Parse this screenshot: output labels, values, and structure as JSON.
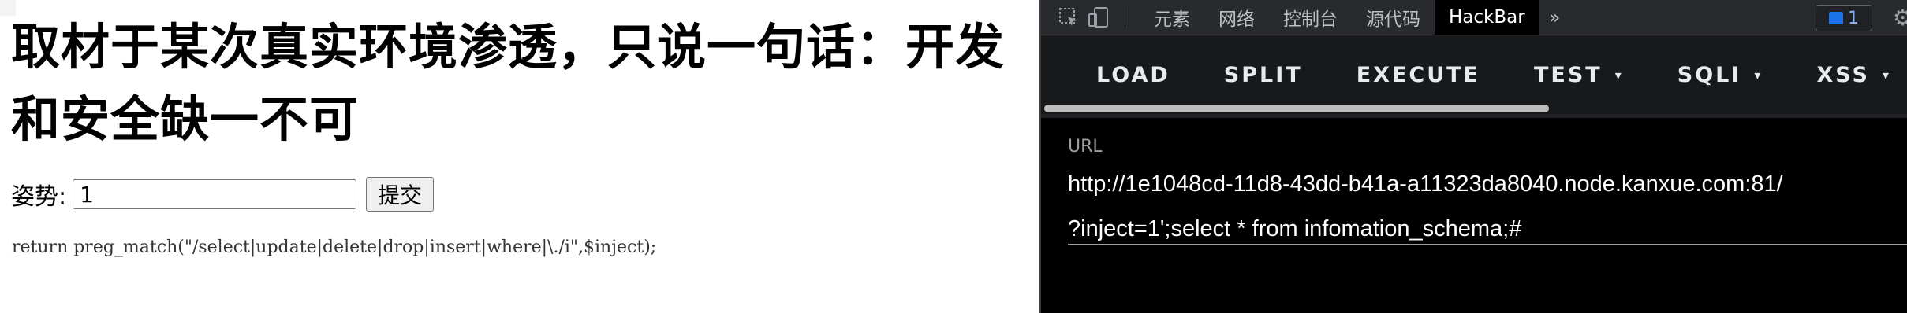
{
  "page": {
    "headline": "取材于某次真实环境渗透，只说一句话：开发和安全缺一不可",
    "form": {
      "label": "姿势:",
      "input_value": "1",
      "submit_label": "提交"
    },
    "code": "return preg_match(\"/select|update|delete|drop|insert|where|\\./i\",$inject);"
  },
  "devtools": {
    "tabs": [
      {
        "label": "元素"
      },
      {
        "label": "网络"
      },
      {
        "label": "控制台"
      },
      {
        "label": "源代码"
      },
      {
        "label": "HackBar"
      }
    ],
    "active_tab": "HackBar",
    "more_label": "»",
    "badge_count": "1",
    "icons": [
      "inspect-icon",
      "device-toggle-icon",
      "overflow-chevrons-icon",
      "message-icon",
      "gear-icon"
    ]
  },
  "hackbar": {
    "buttons": [
      {
        "label": "LOAD"
      },
      {
        "label": "SPLIT"
      },
      {
        "label": "EXECUTE"
      },
      {
        "label": "TEST",
        "caret": "▾"
      },
      {
        "label": "SQLI",
        "caret": "▾"
      },
      {
        "label": "XSS",
        "caret": "▾"
      }
    ],
    "url_label": "URL",
    "url_line1": "http://1e1048cd-11d8-43dd-b41a-a11323da8040.node.kanxue.com:81/",
    "url_line2": "?inject=1';select * from infomation_schema;#"
  },
  "colors": {
    "devtools_bg": "#202124",
    "hackbar_bg": "#18191b",
    "active_tab_bg": "#000000"
  }
}
